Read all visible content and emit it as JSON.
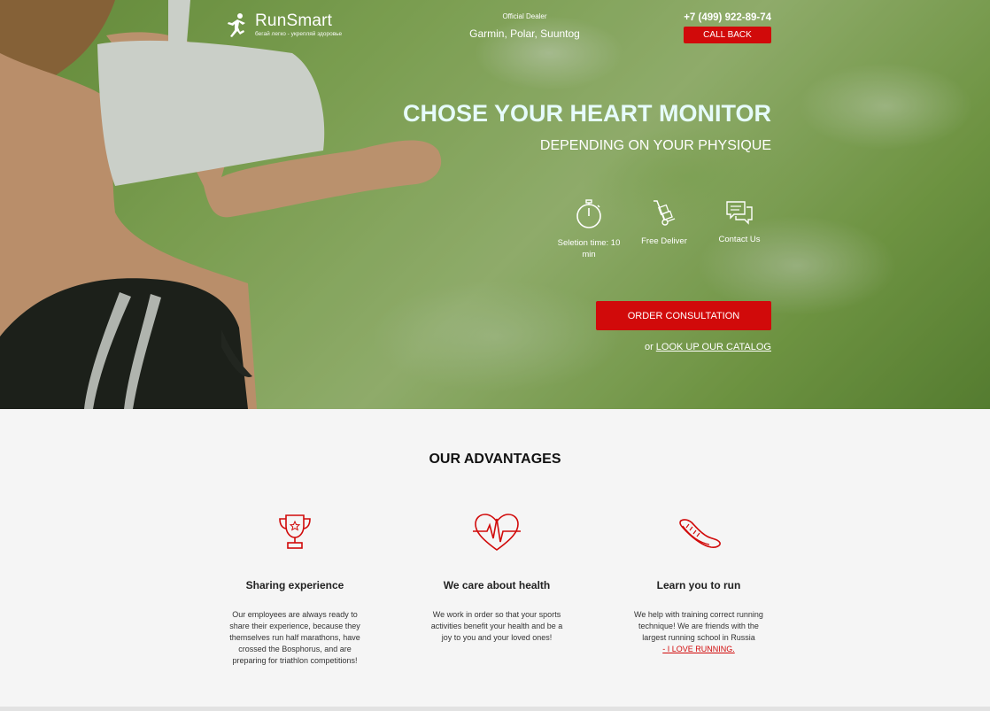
{
  "brand": {
    "name": "RunSmart",
    "tagline": "бегай легко - укрепляй здоровье"
  },
  "dealer": {
    "label": "Official Dealer",
    "brands": "Garmin, Polar, Suuntog"
  },
  "contact": {
    "phone": "+7 (499) 922-89-74",
    "callback_label": "CALL BACK"
  },
  "hero": {
    "title": "CHOSE YOUR HEART MONITOR",
    "subtitle": "DEPENDING ON YOUR PHYSIQUE",
    "features": [
      {
        "icon": "stopwatch-icon",
        "label": "Seletion time: 10 min"
      },
      {
        "icon": "hand-truck-icon",
        "label": "Free Deliver"
      },
      {
        "icon": "chat-icon",
        "label": "Contact Us"
      }
    ],
    "order_label": "ORDER CONSULTATION",
    "catalog_prefix": "or",
    "catalog_link": "LOOK UP OUR CATALOG"
  },
  "advantages": {
    "title": "OUR ADVANTAGES",
    "items": [
      {
        "icon": "trophy-icon",
        "heading": "Sharing experience",
        "text": "Our employees are always ready to share their experience, because they themselves run half marathons, have crossed the Bosphorus, and are preparing for triathlon competitions!"
      },
      {
        "icon": "heartbeat-icon",
        "heading": "We care about health",
        "text": "We work in order so that your sports activities benefit your health and be a joy to you and your loved ones!"
      },
      {
        "icon": "running-shoe-icon",
        "heading": "Learn you to run",
        "text": "We help with training correct running technique! We are friends with the largest running school in Russia",
        "link": "- I LOVE RUNNING."
      }
    ]
  },
  "colors": {
    "accent": "#d10a0a",
    "hero_title": "#e6fbfb",
    "section_bg": "#f5f5f5"
  }
}
